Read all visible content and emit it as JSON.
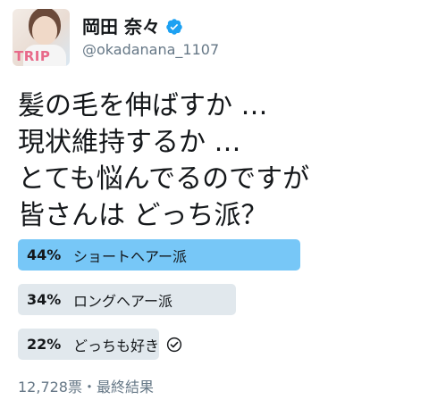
{
  "author": {
    "display_name": "岡田 奈々",
    "handle": "@okadanana_1107",
    "verified_icon": "verified-badge-icon",
    "avatar_text": "TRIP"
  },
  "tweet": {
    "text": "髪の毛を伸ばすか …\n現状維持するか …\nとても悩んでるのですが\n皆さんは どっち派？"
  },
  "poll": {
    "options": [
      {
        "percent": "44%",
        "fraction": 0.44,
        "label": "ショートヘアー派",
        "winner": true,
        "selected": false
      },
      {
        "percent": "34%",
        "fraction": 0.34,
        "label": "ロングヘアー派",
        "winner": false,
        "selected": false
      },
      {
        "percent": "22%",
        "fraction": 0.22,
        "label": "どっちも好き",
        "winner": false,
        "selected": true
      }
    ],
    "summary": "12,728票・最終結果"
  },
  "colors": {
    "winner_bar": "#77c7f7",
    "other_bar": "#e1e8ed",
    "verified": "#1da1f2",
    "secondary_text": "#657786"
  }
}
